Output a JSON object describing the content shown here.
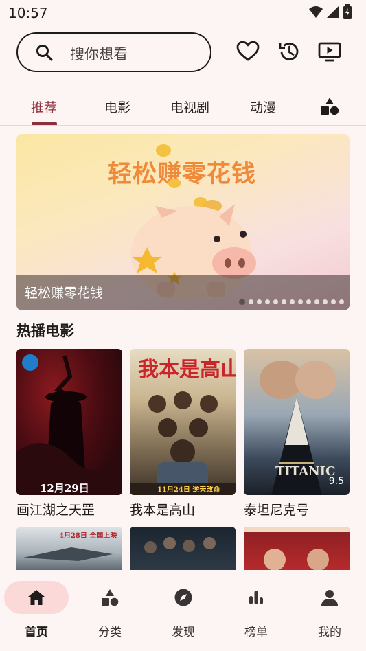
{
  "status_bar": {
    "time": "10:57"
  },
  "search": {
    "placeholder": "搜你想看"
  },
  "tabs": [
    {
      "label": "推荐",
      "active": true
    },
    {
      "label": "电影",
      "active": false
    },
    {
      "label": "电视剧",
      "active": false
    },
    {
      "label": "动漫",
      "active": false
    }
  ],
  "banner": {
    "headline": "轻松赚零花钱",
    "caption": "轻松赚零花钱",
    "slide_count": 13,
    "active_slide": 1
  },
  "hot_movies": {
    "title": "热播电影",
    "items": [
      {
        "title": "画江湖之天罡",
        "poster_text": "12月29日"
      },
      {
        "title": "我本是高山",
        "poster_text": "11月24日 逆天改命"
      },
      {
        "title": "泰坦尼克号",
        "poster_text": "TITANIC",
        "rating": "9.5"
      }
    ],
    "second_row": [
      {
        "poster_text": "4月28日 全国上映"
      },
      {
        "poster_text": ""
      },
      {
        "poster_text": ""
      }
    ]
  },
  "bottom_nav": [
    {
      "label": "首页",
      "icon": "home-icon",
      "active": true
    },
    {
      "label": "分类",
      "icon": "category-icon",
      "active": false
    },
    {
      "label": "发现",
      "icon": "compass-icon",
      "active": false
    },
    {
      "label": "榜单",
      "icon": "chart-icon",
      "active": false
    },
    {
      "label": "我的",
      "icon": "person-icon",
      "active": false
    }
  ],
  "colors": {
    "accent": "#8e2f3e",
    "background": "#fdf5f3",
    "nav_pill": "#fbd9d8"
  }
}
